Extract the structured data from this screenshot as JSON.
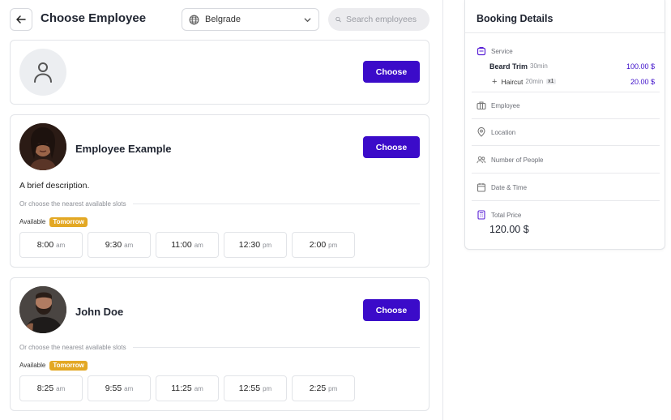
{
  "header": {
    "title": "Choose Employee",
    "location": "Belgrade",
    "search_placeholder": "Search employees"
  },
  "cards": {
    "any": {
      "choose_label": "Choose"
    },
    "employee1": {
      "name": "Employee Example",
      "choose_label": "Choose",
      "description": "A brief description.",
      "nearest_label": "Or choose the nearest available slots",
      "available_label": "Available",
      "badge": "Tomorrow",
      "slots": [
        {
          "time": "8:00",
          "period": "am"
        },
        {
          "time": "9:30",
          "period": "am"
        },
        {
          "time": "11:00",
          "period": "am"
        },
        {
          "time": "12:30",
          "period": "pm"
        },
        {
          "time": "2:00",
          "period": "pm"
        }
      ]
    },
    "employee2": {
      "name": "John Doe",
      "choose_label": "Choose",
      "nearest_label": "Or choose the nearest available slots",
      "available_label": "Available",
      "badge": "Tomorrow",
      "slots": [
        {
          "time": "8:25",
          "period": "am"
        },
        {
          "time": "9:55",
          "period": "am"
        },
        {
          "time": "11:25",
          "period": "am"
        },
        {
          "time": "12:55",
          "period": "pm"
        },
        {
          "time": "2:25",
          "period": "pm"
        }
      ]
    }
  },
  "booking": {
    "title": "Booking Details",
    "service_label": "Service",
    "services": [
      {
        "name": "Beard Trim",
        "duration": "30min",
        "price": "100.00 $"
      },
      {
        "name": "Haircut",
        "duration": "20min",
        "qty": "x1",
        "price": "20.00 $"
      }
    ],
    "employee_label": "Employee",
    "location_label": "Location",
    "people_label": "Number of People",
    "datetime_label": "Date & Time",
    "total_label": "Total Price",
    "total_value": "120.00 $"
  },
  "colors": {
    "primary": "#3b0bc9",
    "badge": "#e3a824"
  }
}
